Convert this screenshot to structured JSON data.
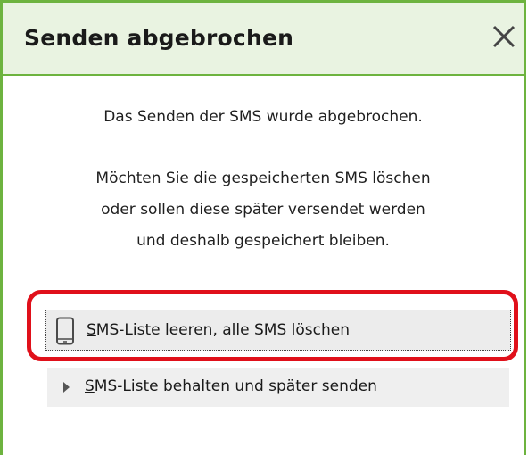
{
  "dialog": {
    "title": "Senden abgebrochen",
    "close_icon": "close-icon",
    "message_line1": "Das Senden der SMS wurde abgebrochen.",
    "message_line2": "Möchten Sie die gespeicherten SMS löschen",
    "message_line3": "oder sollen diese später versendet werden",
    "message_line4": "und deshalb gespeichert bleiben."
  },
  "options": [
    {
      "label": "SMS-Liste leeren, alle SMS löschen",
      "icon": "phone-icon",
      "highlighted": true,
      "focused": true
    },
    {
      "label": "SMS-Liste behalten und später senden",
      "icon": "arrow-right-icon",
      "highlighted": false,
      "focused": false
    }
  ],
  "colors": {
    "frame_border": "#6db33f",
    "titlebar_bg": "#e9f3e1",
    "highlight_ring": "#e0101a",
    "option_bg": "#efefef"
  }
}
